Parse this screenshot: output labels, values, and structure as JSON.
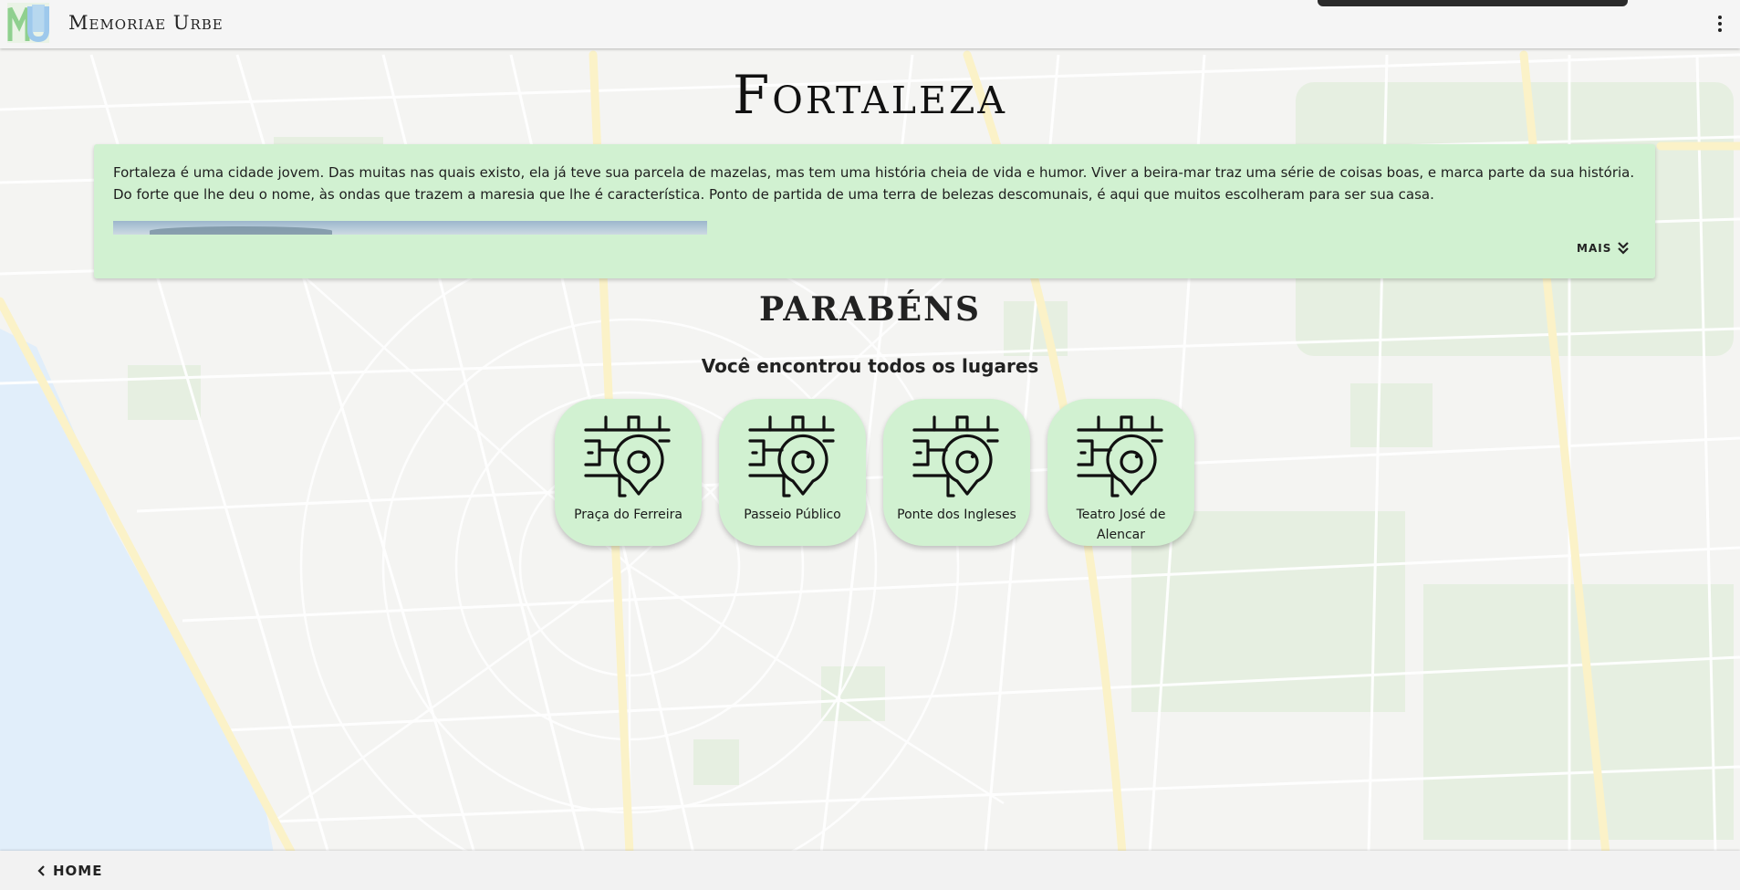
{
  "app": {
    "title": "Memoriae Urbe",
    "logo_letters": "MU"
  },
  "page": {
    "city_name": "Fortaleza",
    "description": "Fortaleza é uma cidade jovem. Das muitas nas quais existo, ela já teve sua parcela de mazelas, mas tem uma história cheia de vida e humor. Viver a beira-mar traz uma série de coisas boas, e marca parte da sua história. Do forte que lhe deu o nome, às ondas que trazem a maresia que lhe é característica. Ponto de partida de uma terra de belezas descomunais, é aqui que muitos escolheram para ser sua casa.",
    "more_label": "MAIS",
    "congrats_title": "PARABÉNS",
    "congrats_subtitle": "Você encontrou todos os lugares"
  },
  "places": [
    {
      "label": "Praça do Ferreira",
      "icon": "map-pin-icon"
    },
    {
      "label": "Passeio Público",
      "icon": "map-pin-icon"
    },
    {
      "label": "Ponte dos Ingleses",
      "icon": "map-pin-icon"
    },
    {
      "label": "Teatro José de Alencar",
      "icon": "map-pin-icon"
    }
  ],
  "footer": {
    "home_label": "HOME"
  },
  "colors": {
    "card_green": "#d1f1d1",
    "map_background": "#f4f4f2",
    "water": "#e1eefa",
    "major_road": "#fbf2c8"
  }
}
